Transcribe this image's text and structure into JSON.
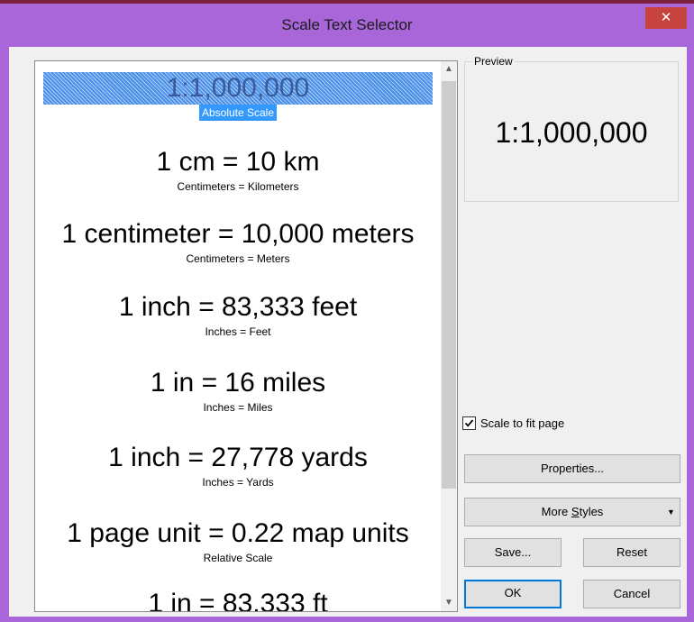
{
  "window": {
    "title": "Scale Text Selector",
    "close_glyph": "✕"
  },
  "list": {
    "items": [
      {
        "text": "1:1,000,000",
        "caption": "Absolute Scale",
        "selected": true
      },
      {
        "text": "1 cm = 10 km",
        "caption": "Centimeters = Kilometers"
      },
      {
        "text": "1 centimeter = 10,000 meters",
        "caption": "Centimeters = Meters"
      },
      {
        "text": "1 inch = 83,333 feet",
        "caption": "Inches = Feet"
      },
      {
        "text": "1 in = 16 miles",
        "caption": "Inches = Miles"
      },
      {
        "text": "1 inch = 27,778 yards",
        "caption": "Inches = Yards"
      },
      {
        "text": "1 page unit = 0.22 map units",
        "caption": "Relative Scale"
      },
      {
        "text": "1 in = 83,333 ft",
        "caption": ""
      }
    ],
    "scroll_up_glyph": "▲",
    "scroll_down_glyph": "▼"
  },
  "preview": {
    "label": "Preview",
    "text": "1:1,000,000"
  },
  "options": {
    "scale_to_fit_label": "Scale to fit page",
    "scale_to_fit_checked": true
  },
  "buttons": {
    "properties": "Properties...",
    "more_styles_pre": "More ",
    "more_styles_accel": "S",
    "more_styles_post": "tyles",
    "more_styles_arrow": "▼",
    "save": "Save...",
    "reset": "Reset",
    "ok": "OK",
    "cancel": "Cancel"
  },
  "colors": {
    "title_bar": "#a866d8",
    "close_button": "#c7433f",
    "selection": "#3399ff"
  },
  "icons": {
    "close": "close-icon",
    "checkbox": "checkmark-icon",
    "scroll_up": "chevron-up-icon",
    "scroll_down": "chevron-down-icon",
    "dropdown": "dropdown-arrow-icon"
  }
}
